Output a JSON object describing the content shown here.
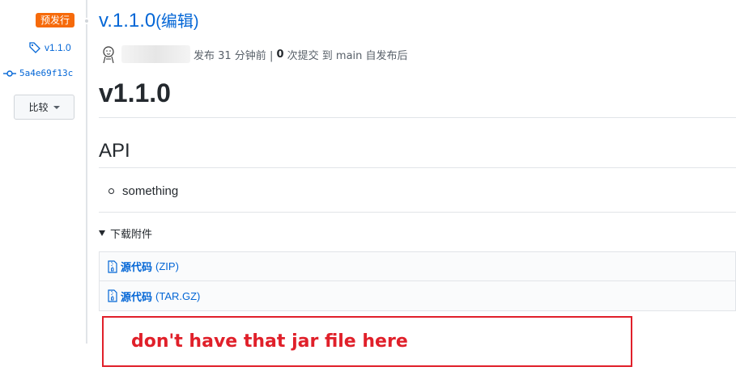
{
  "sidebar": {
    "badge": "预发行",
    "tag": "v1.1.0",
    "commit": "5a4e69f13c",
    "compare_label": "比较"
  },
  "release": {
    "title": "v.1.1.0",
    "edit_label": "(编辑)",
    "meta_published": "发布 31 分钟前 |",
    "meta_commits_count": "0",
    "meta_commits_suffix": "次提交 到 main 自发布后",
    "heading": "v1.1.0",
    "section_heading": "API",
    "list_items": [
      "something"
    ],
    "downloads_label": "下载附件",
    "assets": [
      {
        "name": "源代码",
        "type": "(ZIP)"
      },
      {
        "name": "源代码",
        "type": "(TAR.GZ)"
      }
    ]
  },
  "annotation": {
    "text": "don't have that jar file here",
    "color": "#e0202a"
  },
  "colors": {
    "link": "#0366d6",
    "badge": "#f66a0a"
  }
}
